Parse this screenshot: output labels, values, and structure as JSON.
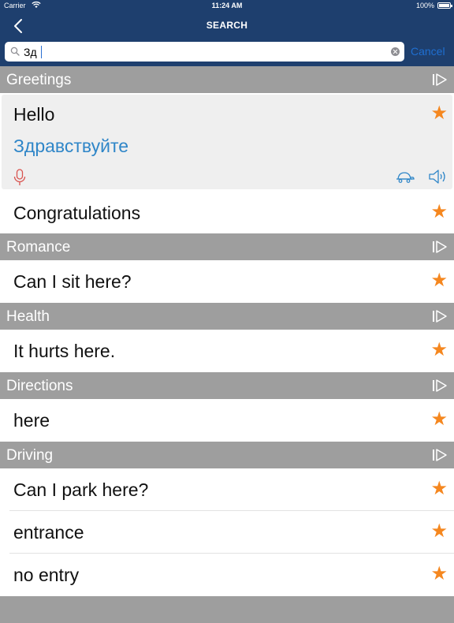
{
  "status_bar": {
    "carrier": "Carrier",
    "time": "11:24 AM",
    "battery": "100%"
  },
  "nav": {
    "title": "SEARCH"
  },
  "search": {
    "value": "Зд",
    "cancel_label": "Cancel"
  },
  "colors": {
    "nav_background": "#1e3f6e",
    "section_background": "#9e9e9e",
    "accent_star": "#f5871f",
    "translation": "#2f86c8",
    "mic": "#d9534f",
    "link": "#1f6fd1"
  },
  "sections": [
    {
      "title": "Greetings",
      "expanded": {
        "phrase": "Hello",
        "translation": "Здравствуйте"
      },
      "items": [
        "Congratulations"
      ]
    },
    {
      "title": "Romance",
      "items": [
        "Can I sit here?"
      ]
    },
    {
      "title": "Health",
      "items": [
        "It hurts here."
      ]
    },
    {
      "title": "Directions",
      "items": [
        "here"
      ]
    },
    {
      "title": "Driving",
      "items": [
        "Can I park here?",
        "entrance",
        "no entry"
      ]
    }
  ]
}
